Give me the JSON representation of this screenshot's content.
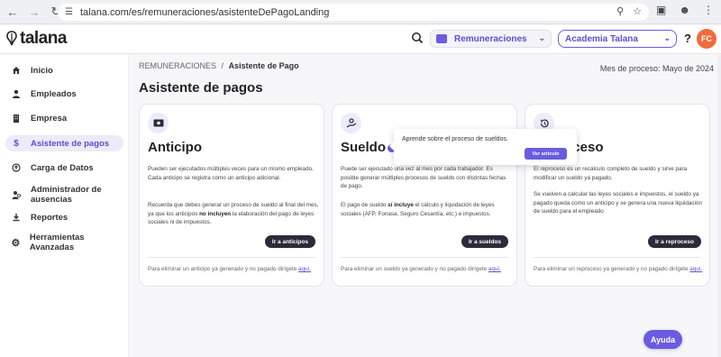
{
  "browser": {
    "url": "talana.com/es/remuneraciones/asistenteDePagoLanding"
  },
  "header": {
    "logo": "talana",
    "module": "Remuneraciones",
    "company": "Academia Talana",
    "help": "?",
    "avatar": "FC"
  },
  "sidebar": {
    "items": [
      {
        "label": "Inicio",
        "icon": "home-icon"
      },
      {
        "label": "Empleados",
        "icon": "user-icon"
      },
      {
        "label": "Empresa",
        "icon": "building-icon"
      },
      {
        "label": "Asistente de pagos",
        "icon": "dollar-icon",
        "active": true
      },
      {
        "label": "Carga de Datos",
        "icon": "upload-circle-icon"
      },
      {
        "label": "Administrador de ausencias",
        "icon": "user-clock-icon"
      },
      {
        "label": "Reportes",
        "icon": "download-icon"
      },
      {
        "label": "Herramientas Avanzadas",
        "icon": "gear-icon"
      }
    ]
  },
  "main": {
    "breadcrumb_root": "REMUNERACIONES",
    "breadcrumb_sep": "/",
    "breadcrumb_current": "Asistente de Pago",
    "period": "Mes de proceso: Mayo de 2024",
    "title": "Asistente de pagos"
  },
  "cards": {
    "anticipo": {
      "title": "Anticipo",
      "p1": "Pueden ser ejecutados múltiples veces para un mismo empleado. Cada anticipo se registra como un anticipo adicional.",
      "p2a": "Recuerda que debes generar un proceso de sueldo al final del mes, ya que los anticipos ",
      "p2b": "no incluyen",
      "p2c": " la elaboración del pago de leyes sociales ni de impuestos.",
      "button": "Ir a anticipos",
      "foot": "Para eliminar un anticipo ya generado y no pagado dirígete ",
      "link": "aquí."
    },
    "sueldo": {
      "title": "Sueldo",
      "p1": "Puede ser ejecutado una vez al mes por cada trabajador. Es posible generar múltiples procesos de sueldo con distintas fechas de pago.",
      "p2a": "El pago de sueldo ",
      "p2b": "sí incluye",
      "p2c": " el cálculo y liquidación de leyes sociales (AFP, Fonasa, Seguro Cesantía, etc.) e impuestos.",
      "button": "Ir a sueldos",
      "foot": "Para eliminar un sueldo ya generado y no pagado dirígete ",
      "link": "aquí."
    },
    "reproceso": {
      "title": "Reproceso",
      "p1": "El reproceso es un recálculo completo de sueldo y sirve para modificar un sueldo ya pagado.",
      "p2": "Se vuelven a calcular las leyes sociales e impuestos, el sueldo ya pagado queda como un anticipo y se genera una nueva liquidación de sueldo para el empleado",
      "button": "Ir a reproceso",
      "foot": "Para eliminar un reproceso ya generado y no pagado dirígete ",
      "link": "aquí."
    }
  },
  "popover": {
    "text": "Aprende sobre el proceso de sueldos.",
    "button": "Ver artículo"
  },
  "ayuda": "Ayuda",
  "colors": {
    "accent": "#6a5ce0",
    "dark_button": "#2b2b3a",
    "avatar": "#f06a3d"
  }
}
